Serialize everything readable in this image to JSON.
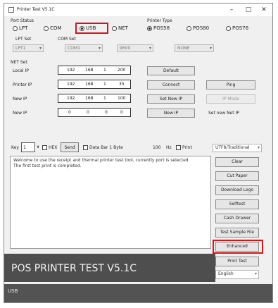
{
  "window": {
    "title": "Printer Test V5.1C",
    "minimize": "–",
    "maximize": "□",
    "close": "✕"
  },
  "port_status": {
    "label": "Port Status",
    "options": [
      "LPT",
      "COM",
      "USB",
      "NET"
    ],
    "selected": "USB"
  },
  "printer_type": {
    "label": "Printer Type",
    "options": [
      "POS58",
      "POS80",
      "POS76"
    ],
    "selected": "POS58"
  },
  "lpt_set": {
    "label": "LPT Set",
    "value": "LPT1"
  },
  "com_set": {
    "label": "COM Set",
    "fields": [
      "COM1",
      "9600",
      "NONE"
    ]
  },
  "net_set": {
    "label": "NET Set",
    "rows": [
      {
        "label": "Local IP",
        "octets": [
          "192",
          "168",
          "1",
          "200"
        ],
        "button": "Default"
      },
      {
        "label": "Printer IP",
        "octets": [
          "192",
          "168",
          "1",
          "35"
        ],
        "button": "Connect",
        "side_button": "Ping"
      },
      {
        "label": "New IP",
        "octets": [
          "192",
          "168",
          "1",
          "100"
        ],
        "button": "Set New IP",
        "side_button": "IP Mode"
      },
      {
        "label": "New IP",
        "octets": [
          "0",
          "0",
          "0",
          "0"
        ],
        "button": "New IP",
        "side_label": "Set new Net IP"
      }
    ]
  },
  "toolbar": {
    "key_label": "Key",
    "key_value": "1",
    "hex_label": "HEX",
    "send_label": "Send",
    "checkbox_label": "Data Bar 1 Byte",
    "byte_value": "100",
    "hz_label": "Hz",
    "print_label": "Print",
    "dropdown_value": "UTF8/Traditional"
  },
  "log_text": [
    "Welcome to use the receipt and thermal printer test tool, currently port is selected.",
    "The first test print is completed."
  ],
  "side_buttons": [
    "Clear",
    "Cut Paper",
    "Download Logo",
    "Selftest",
    "Cash Drawer",
    "Test Sample File",
    "Enhanced",
    "Print Test"
  ],
  "highlighted_button": "Enhanced",
  "language": "English",
  "banner": "POS PRINTER TEST V5.1C",
  "status": "USB",
  "colors": {
    "highlight": "#d8141a",
    "banner_bg": "#4e4e4e",
    "status_bg": "#535353"
  }
}
